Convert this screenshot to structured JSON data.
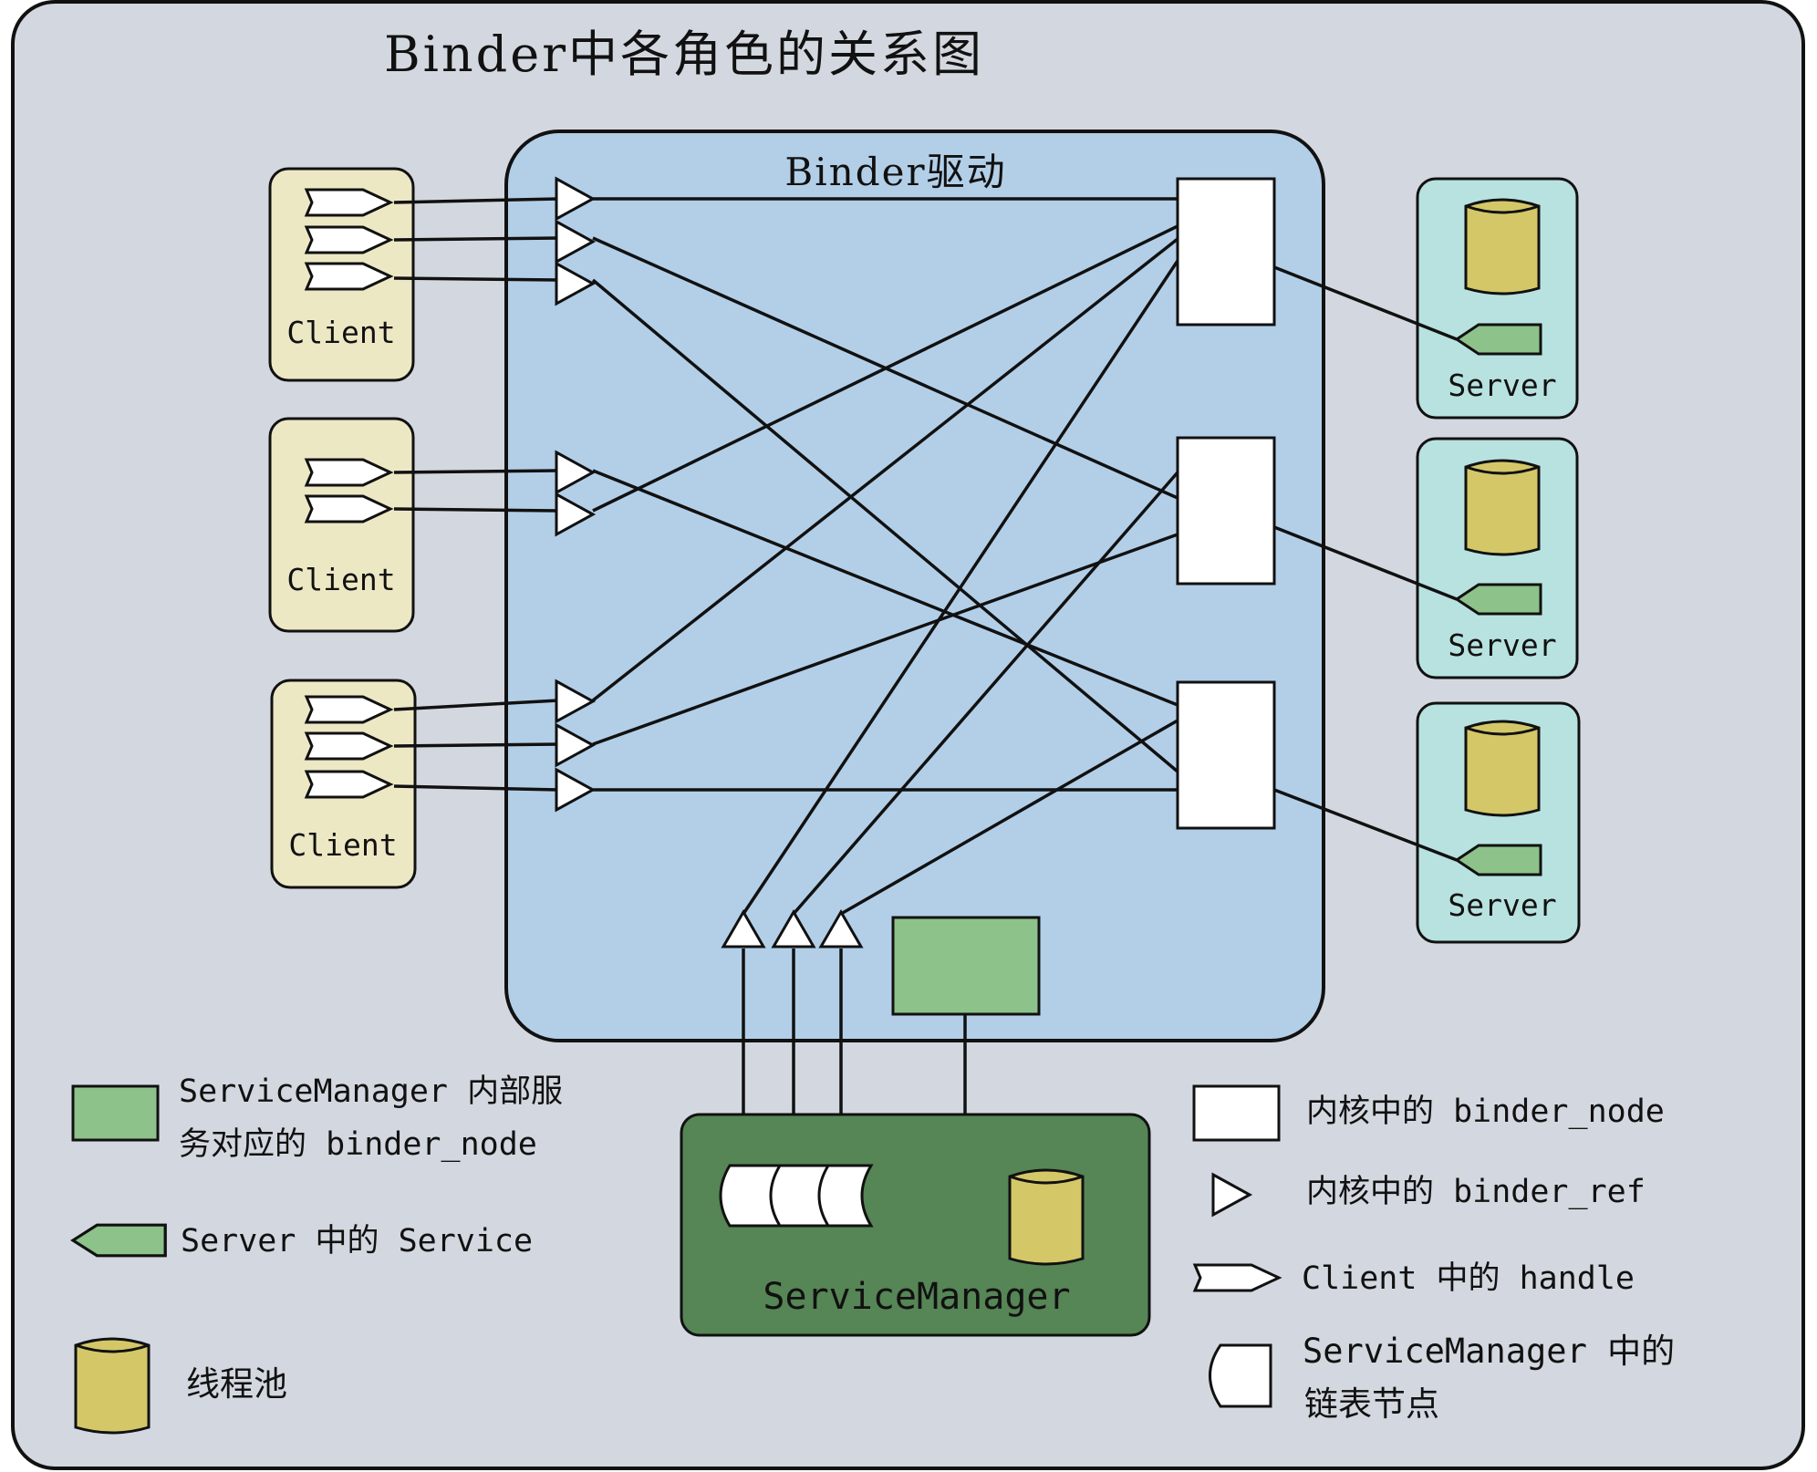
{
  "title": "Binder中各角色的关系图",
  "driver_label": "Binder驱动",
  "client_label": "Client",
  "server_label": "Server",
  "service_manager_label": "ServiceManager",
  "legend": {
    "sm_node_line1": "ServiceManager 内部服",
    "sm_node_line2": "务对应的 binder_node",
    "service": "Server 中的 Service",
    "thread_pool": "线程池",
    "binder_node": "内核中的 binder_node",
    "binder_ref": "内核中的 binder_ref",
    "handle": "Client 中的 handle",
    "list_node_line1": "ServiceManager 中的",
    "list_node_line2": "链表节点"
  },
  "colors": {
    "background": "#d3d8e0",
    "driver": "#b3cfe8",
    "client": "#ede8c4",
    "server": "#b7e2e0",
    "service_manager": "#568556",
    "sm_node": "#8dc28b",
    "service": "#8dc28b",
    "cylinder": "#d4c768"
  }
}
